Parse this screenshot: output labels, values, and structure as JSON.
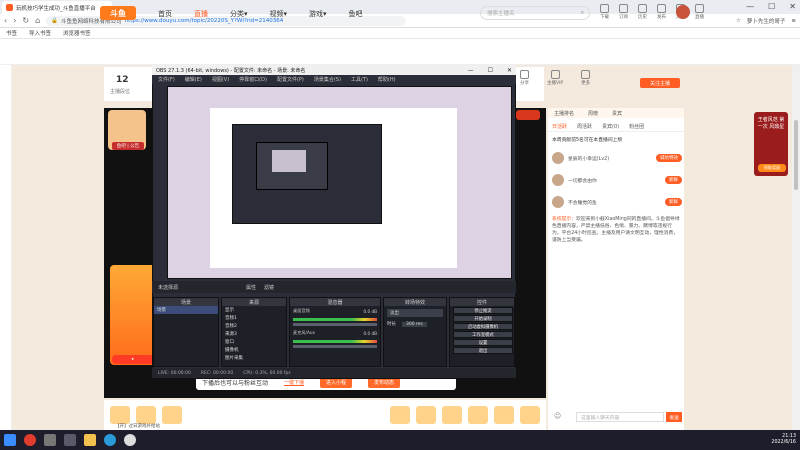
{
  "browser": {
    "tab_title": "玩机技巧学生成功_斗鱼直播平台",
    "url_site": "斗鱼鱼网络科技有限公司",
    "url": "https://www.douyu.com/topic/20220S_Y?WI?rid=2140364",
    "addr_right": "萝卜先生的哥子",
    "bookmarks": [
      "书签",
      "导入书签",
      "浏览器书签"
    ],
    "window_controls": [
      "—",
      "☐",
      "✕"
    ]
  },
  "site": {
    "logo": "斗鱼",
    "nav": [
      "首页",
      "直播",
      "分类▾",
      "视频▾",
      "游戏▾",
      "鱼吧"
    ],
    "search_placeholder": "搜索主播名",
    "header_icons": [
      "下载",
      "订阅",
      "历史",
      "发布",
      "消息",
      "直播"
    ]
  },
  "room": {
    "level": "12",
    "level_label": "主播段位",
    "icons": [
      "分享",
      "主播VIP",
      "更多"
    ],
    "follow": "关注主播",
    "anchor_name": "鱼吧 | 公告"
  },
  "obs": {
    "title": "OBS 27.1.3 (64-bit, windows) - 配置文件: 未命名 - 场景: 未命名",
    "menu": [
      "文件(F)",
      "编辑(E)",
      "视图(V)",
      "停靠窗口(D)",
      "配置文件(P)",
      "场景集合(S)",
      "工具(T)",
      "帮助(H)"
    ],
    "status_scene": "未选择源",
    "status_items": [
      "属性",
      "滤镜"
    ],
    "panels": {
      "scene": {
        "title": "场景",
        "items": [
          "场景"
        ]
      },
      "source": {
        "title": "来源",
        "items": [
          "显示",
          "音频1",
          "音频2",
          "来源3",
          "窗口",
          "摄像机",
          "图片采集"
        ]
      },
      "mixer": {
        "title": "混音器",
        "tracks": [
          "桌面音频",
          "麦克风/Aux"
        ],
        "levels": [
          "0.0 dB",
          "0.0 dB"
        ]
      },
      "trans": {
        "title": "转场特效",
        "mode": "淡出",
        "duration_label": "时长",
        "duration": "300 ms"
      },
      "ctrl": {
        "title": "控件",
        "buttons": [
          "停止推流",
          "开始录制",
          "启动虚拟摄像机",
          "工作室模式",
          "设置",
          "退出"
        ]
      }
    },
    "footer": [
      "LIVE: 00:00:00",
      "REC: 00:00:00",
      "CPU: 0.3%, 60.00 fps"
    ]
  },
  "interact": {
    "text": "下播后也可以与粉丝互动",
    "link": "一键下播",
    "btn1": "进入小程",
    "btn2": "发布动态"
  },
  "gift_caption": "【开】过日游戏补给站",
  "chat": {
    "tabs": [
      "主播排名",
      "周榜",
      "贵宾"
    ],
    "tabs2": [
      "日活跃",
      "周活跃",
      "贵宾(0)",
      "粉丝团"
    ],
    "notice": "本周贡献前5名可在本直播间上榜",
    "rows": [
      {
        "name": "星辰的小幸运(Lv2)",
        "tag": "城坑特效"
      },
      {
        "name": "一切都会由你",
        "tag": "新鲜"
      },
      {
        "name": "不会睡觉的鱼",
        "tag": "新鲜"
      }
    ],
    "sys_label": "系统提示：",
    "sys_text": "欢迎来到小截XiaoMing同的直播间。斗鱼倡导绿色直播内容，严禁主播低俗、色情、暴力、赌博等违规行为，平台24小时巡查。主播及用户请文明互动，理性消费，谨防上当受骗。",
    "input_placeholder": "这里输入聊天内容",
    "send": "发送"
  },
  "ad": {
    "text": "王者风范 第一次 风鼎星",
    "btn": "领取奖励"
  },
  "taskbar": {
    "time": "21:13",
    "date": "2022/6/16"
  }
}
